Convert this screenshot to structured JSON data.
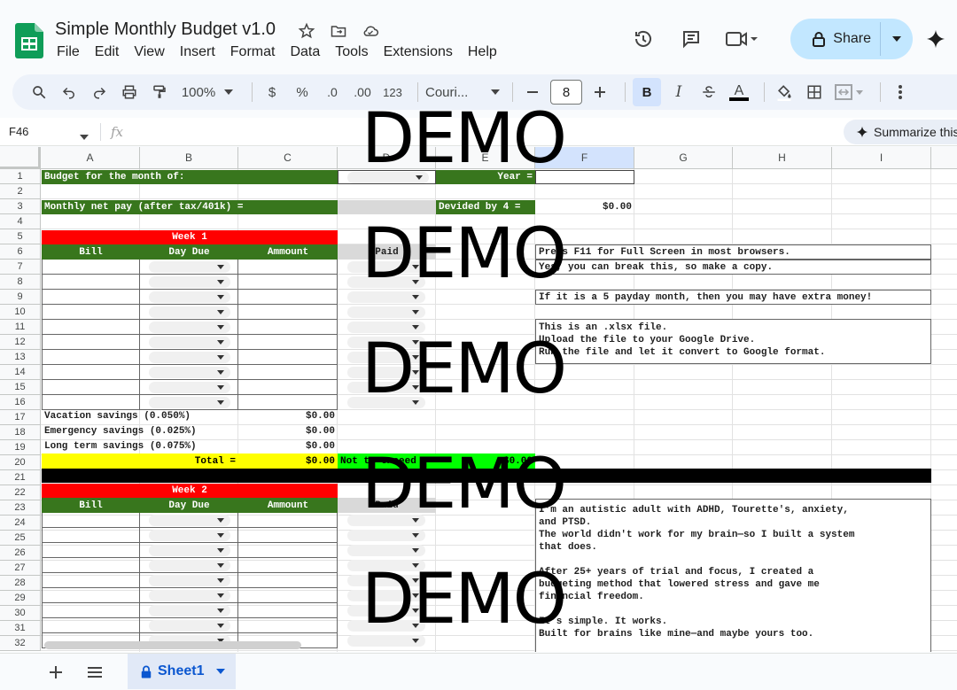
{
  "header": {
    "doc_title": "Simple Monthly Budget v1.0",
    "menu": [
      "File",
      "Edit",
      "View",
      "Insert",
      "Format",
      "Data",
      "Tools",
      "Extensions",
      "Help"
    ],
    "share_label": "Share"
  },
  "toolbar": {
    "zoom": "100%",
    "currency": "$",
    "percent": "%",
    "dec_decrease": ".0",
    "dec_increase": ".00",
    "number_format": "123",
    "font": "Couri...",
    "font_size": "8",
    "bold": "B",
    "italic": "I",
    "text_color": "A"
  },
  "formula_bar": {
    "cell_ref": "F46",
    "fx": "fx",
    "summarize": "Summarize this"
  },
  "columns": [
    "A",
    "B",
    "C",
    "D",
    "E",
    "F",
    "G",
    "H",
    "I"
  ],
  "rows": [
    "1",
    "2",
    "3",
    "4",
    "5",
    "6",
    "7",
    "8",
    "9",
    "10",
    "11",
    "12",
    "13",
    "14",
    "15",
    "16",
    "17",
    "18",
    "19",
    "20",
    "21",
    "22",
    "23",
    "24",
    "25",
    "26",
    "27",
    "28",
    "29",
    "30",
    "31",
    "32"
  ],
  "cells": {
    "budget_month_label": "Budget for the month of:",
    "year_label": "Year =",
    "net_pay_label": "Monthly net pay (after tax/401k) =",
    "divided_label": "Devided by 4 =",
    "divided_value": "$0.00",
    "week1": "Week 1",
    "week2": "Week 2",
    "bill": "Bill",
    "day_due": "Day Due",
    "amount": "Ammount",
    "paid": "Paid",
    "vacation": "Vacation savings  (0.050%)",
    "vacation_val": "$0.00",
    "emergency": "Emergency savings (0.025%)",
    "emergency_val": "$0.00",
    "longterm": "Long term savings (0.075%)",
    "longterm_val": "$0.00",
    "total": "Total =",
    "total_val": "$0.00",
    "not_exceed": "Not to exceed",
    "not_exceed_val": "$0.00"
  },
  "notes": {
    "n1": "Press F11 for Full Screen in most browsers.",
    "n2": "Yes, you can break this, so make a copy.",
    "n3": "If it is a 5 payday month, then you may have extra money!",
    "n4_l1": "This is an .xlsx file.",
    "n4_l2": "Upload the file to your Google Drive.",
    "n4_l3": "Run the file and let it convert to Google format.",
    "n5_l1": "I'm an autistic adult with ADHD, Tourette's, anxiety,",
    "n5_l2": "and PTSD.",
    "n5_l3": "The world didn't work for my brain—so I built a system",
    "n5_l4": "that does.",
    "n5_l5": "After 25+ years of trial and focus, I created a",
    "n5_l6": "budgeting method that lowered stress and gave me",
    "n5_l7": "financial freedom.",
    "n5_l8": "It's simple. It works.",
    "n5_l9": "Built for brains like mine—and maybe yours too."
  },
  "watermark": "DEMO",
  "sheet_tab": "Sheet1",
  "colors": {
    "green": "#38761d",
    "red": "#ff0000",
    "yellow": "#ffff00",
    "lime": "#00ff00",
    "share_bg": "#c2e7ff"
  }
}
